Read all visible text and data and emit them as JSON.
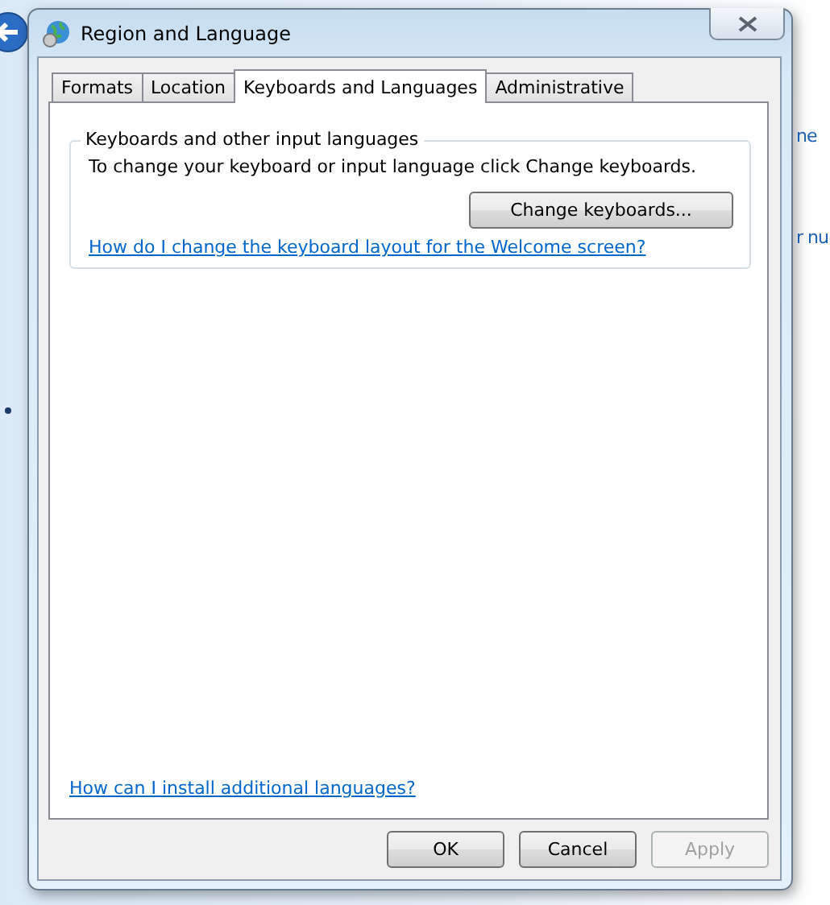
{
  "background": {
    "fragments": [
      "ne",
      "r nu"
    ]
  },
  "window": {
    "title": "Region and Language"
  },
  "tabs": [
    {
      "label": "Formats",
      "selected": false
    },
    {
      "label": "Location",
      "selected": false
    },
    {
      "label": "Keyboards and Languages",
      "selected": true
    },
    {
      "label": "Administrative",
      "selected": false
    }
  ],
  "group": {
    "title": "Keyboards and other input languages",
    "text": "To change your keyboard or input language click Change keyboards.",
    "button": "Change keyboards...",
    "link": "How do I change the keyboard layout for the Welcome screen?"
  },
  "bottom_link": "How can I install additional languages?",
  "buttons": [
    {
      "label": "OK",
      "disabled": false
    },
    {
      "label": "Cancel",
      "disabled": false
    },
    {
      "label": "Apply",
      "disabled": true
    }
  ]
}
